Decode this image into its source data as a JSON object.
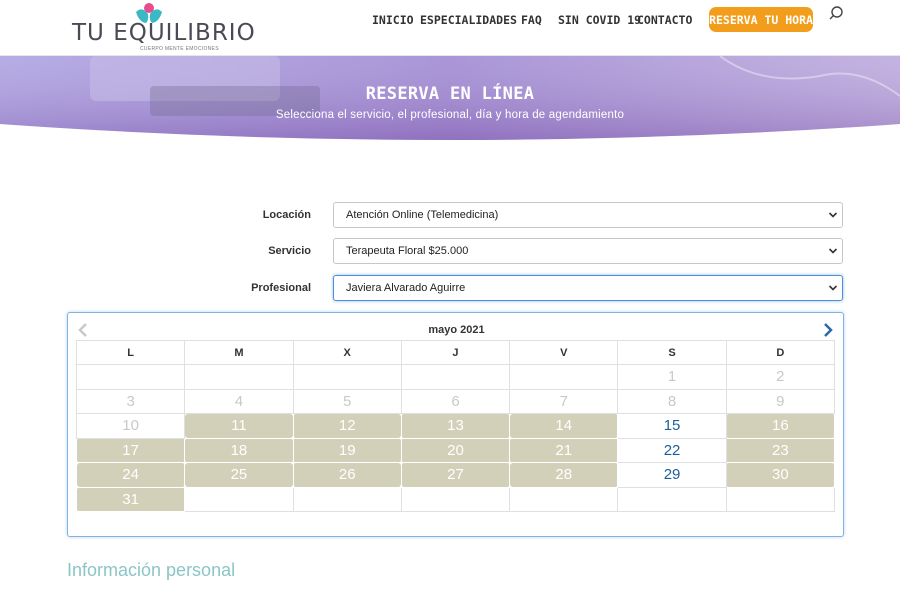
{
  "header": {
    "logo_text": "TU EQUILIBRIO",
    "logo_sub": "CUERPO MENTE EMOCIONES",
    "nav": [
      "INICIO",
      "ESPECIALIDADES",
      "FAQ",
      "SIN COVID 19",
      "CONTACTO"
    ],
    "cta": "RESERVA TU HORA"
  },
  "hero": {
    "title": "RESERVA EN LÍNEA",
    "subtitle": "Selecciona el servicio, el profesional, día y hora de agendamiento"
  },
  "form": {
    "location_label": "Locación",
    "location_value": "Atención Online (Telemedicina)",
    "service_label": "Servicio",
    "service_value": "Terapeuta Floral $25.000",
    "professional_label": "Profesional",
    "professional_value": "Javiera Alvarado Aguirre"
  },
  "calendar": {
    "month": "mayo 2021",
    "weekdays": [
      "L",
      "M",
      "X",
      "J",
      "V",
      "S",
      "D"
    ],
    "weeks": [
      [
        "",
        "",
        "",
        "",
        "",
        "1",
        "2"
      ],
      [
        "3",
        "4",
        "5",
        "6",
        "7",
        "8",
        "9"
      ],
      [
        "10",
        "11",
        "12",
        "13",
        "14",
        "15",
        "16"
      ],
      [
        "17",
        "18",
        "19",
        "20",
        "21",
        "22",
        "23"
      ],
      [
        "24",
        "25",
        "26",
        "27",
        "28",
        "29",
        "30"
      ],
      [
        "31",
        "",
        "",
        "",
        "",
        "",
        ""
      ]
    ],
    "states": [
      [
        "empty",
        "empty",
        "empty",
        "empty",
        "empty",
        "past",
        "past"
      ],
      [
        "past",
        "past",
        "past",
        "past",
        "past",
        "past",
        "past"
      ],
      [
        "unavail",
        "busy",
        "busy",
        "busy",
        "busy",
        "avail",
        "busy"
      ],
      [
        "busy",
        "busy",
        "busy",
        "busy",
        "busy",
        "avail",
        "busy"
      ],
      [
        "busy",
        "busy",
        "busy",
        "busy",
        "busy",
        "avail",
        "busy"
      ],
      [
        "busy",
        "empty",
        "empty",
        "empty",
        "empty",
        "empty",
        "empty"
      ]
    ]
  },
  "section": {
    "personal_info": "Información personal"
  },
  "colors": {
    "cta": "#f29e1c",
    "busy_day": "#d2d0b8",
    "available_day": "#1d5f9a",
    "section_title": "#8cc5c7"
  }
}
